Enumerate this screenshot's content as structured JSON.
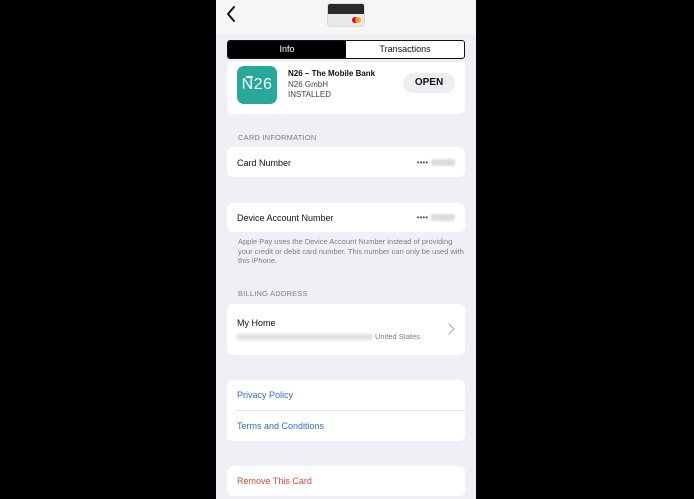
{
  "tabs": [
    {
      "label": "Info",
      "active": true
    },
    {
      "label": "Transactions",
      "active": false
    }
  ],
  "app": {
    "logo_text": "N26",
    "name": "N26 – The Mobile Bank",
    "developer": "N26 GmbH",
    "status": "INSTALLED",
    "open_label": "OPEN",
    "brand_color": "#27a899"
  },
  "card_information": {
    "header": "CARD INFORMATION",
    "card_number_label": "Card Number",
    "card_number_mask": "••••",
    "device_account_label": "Device Account Number",
    "device_account_mask": "••••",
    "note": "Apple Pay uses the Device Account Number instead of providing your credit or debit card number. This number can only be used with this iPhone."
  },
  "billing_address": {
    "header": "BILLING ADDRESS",
    "name": "My Home",
    "country": "United States"
  },
  "links": {
    "privacy": "Privacy Policy",
    "terms": "Terms and Conditions",
    "link_color": "#2d6fc4"
  },
  "remove": {
    "label": "Remove This Card",
    "color": "#d9473a"
  },
  "icons": {
    "back": "chevron-left-icon",
    "card": "card-thumbnail-icon",
    "row_chevron": "chevron-right-icon"
  }
}
